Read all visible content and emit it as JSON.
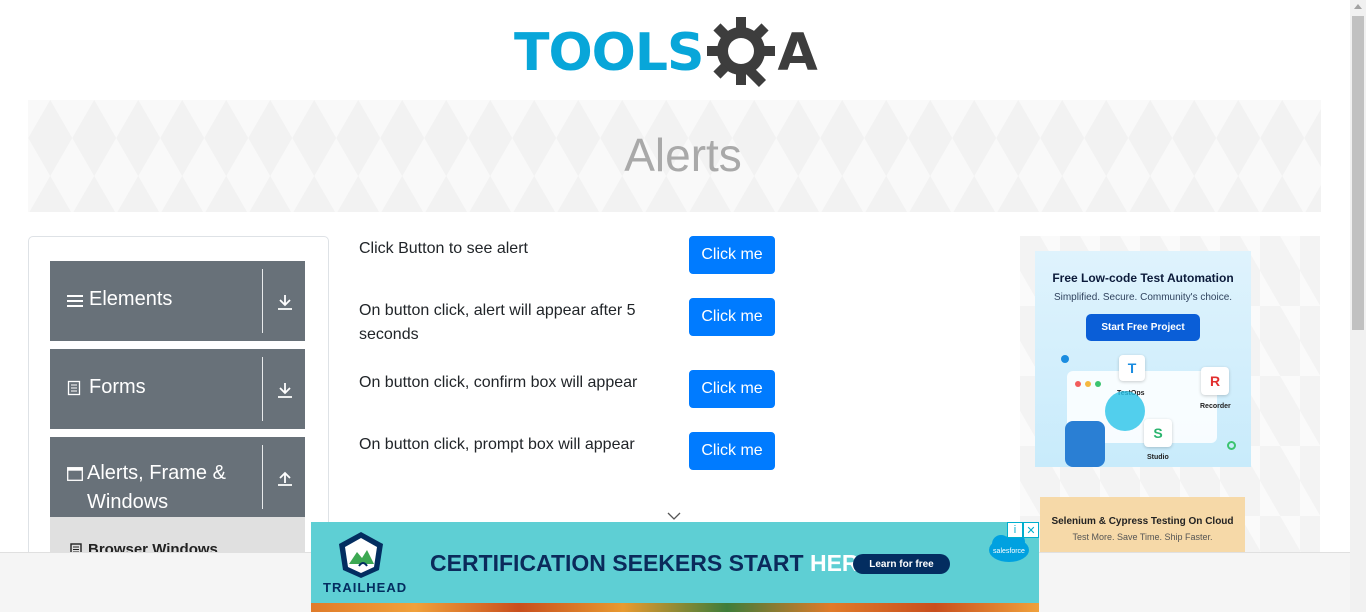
{
  "header": {
    "logo_text": "TOOLS",
    "logo_suffix": "A"
  },
  "banner": {
    "title": "Alerts"
  },
  "sidebar": {
    "groups": [
      {
        "label": "Elements",
        "icon": "hamburger-icon",
        "arrow": "download-icon"
      },
      {
        "label": "Forms",
        "icon": "document-icon",
        "arrow": "download-icon"
      },
      {
        "label": "Alerts, Frame & Windows",
        "icon": "window-icon",
        "arrow": "upload-icon"
      }
    ],
    "active_sub_item": {
      "label": "Browser Windows",
      "icon": "document-icon"
    }
  },
  "alerts": {
    "rows": [
      {
        "text": "Click Button to see alert",
        "button": "Click me"
      },
      {
        "text": "On button click, alert will appear after 5 seconds",
        "button": "Click me"
      },
      {
        "text": "On button click, confirm box will appear",
        "button": "Click me"
      },
      {
        "text": "On button click, prompt box will appear",
        "button": "Click me"
      }
    ]
  },
  "ads": {
    "side1": {
      "title": "Free Low-code Test Automation",
      "subtitle": "Simplified. Secure. Community's choice.",
      "cta": "Start Free Project",
      "products": [
        "TestOps",
        "Recorder",
        "Studio"
      ]
    },
    "side2": {
      "title": "Selenium & Cypress Testing On Cloud",
      "subtitle": "Test More. Save Time. Ship Faster."
    },
    "bottom": {
      "brand": "TRAILHEAD",
      "headline_a": "CERTIFICATION SEEKERS START",
      "headline_b": "HERE.",
      "cta": "Learn for free",
      "partner": "salesforce"
    }
  },
  "colors": {
    "primary_button": "#007bff",
    "sidebar_group": "#687179",
    "logo_blue": "#08a6d9",
    "logo_dark": "#3d3d3d",
    "ad_teal": "#5ecfd4"
  }
}
